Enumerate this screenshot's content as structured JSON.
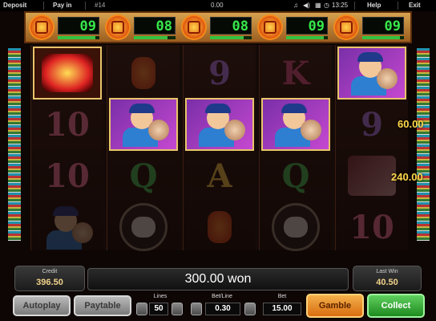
{
  "topbar": {
    "deposit": "Deposit",
    "pay_in": "Pay in",
    "game_number": "#14",
    "balance": "0.00",
    "time": "13:25",
    "help": "Help",
    "exit": "Exit"
  },
  "header": {
    "counters": [
      {
        "value": "09",
        "progress": 0.9
      },
      {
        "value": "08",
        "progress": 0.8
      },
      {
        "value": "08",
        "progress": 0.8
      },
      {
        "value": "09",
        "progress": 0.9
      },
      {
        "value": "09",
        "progress": 0.9
      }
    ]
  },
  "reels": [
    [
      "scatter",
      "10",
      "10",
      "fisherman"
    ],
    [
      "lantern",
      "fisherman",
      "Q",
      "lion"
    ],
    [
      "9",
      "fisherman",
      "A",
      "lantern"
    ],
    [
      "K",
      "fisherman",
      "Q",
      "lion"
    ],
    [
      "fisherman",
      "9",
      "fan",
      "10"
    ]
  ],
  "symbol_letters": {
    "9": "9",
    "10": "10",
    "K": "K",
    "Q": "Q",
    "A": "A"
  },
  "payouts": [
    "60.00",
    "240.00"
  ],
  "credit": {
    "label": "Credit",
    "value": "396.50"
  },
  "message": "300.00 won",
  "last_win": {
    "label": "Last Win",
    "value": "40.50"
  },
  "buttons": {
    "autoplay": "Autoplay",
    "paytable": "Paytable",
    "gamble": "Gamble",
    "collect": "Collect"
  },
  "lines": {
    "label": "Lines",
    "value": "50"
  },
  "bet_line": {
    "label": "Bet/Line",
    "value": "0.30"
  },
  "bet": {
    "label": "Bet",
    "value": "15.00"
  },
  "colors": {
    "lcd_green": "#37e64a",
    "gamble_orange": "#e88a1c",
    "collect_green": "#2fa82f",
    "win_purple": "#c548d0"
  }
}
